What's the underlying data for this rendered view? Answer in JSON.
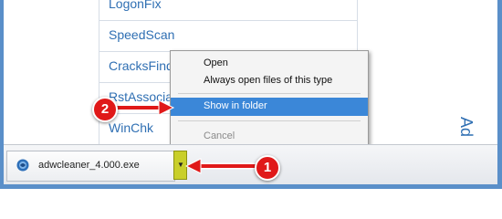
{
  "links": [
    "LogonFix",
    "SpeedScan",
    "CracksFinder",
    "RstAssociations",
    "WinChk"
  ],
  "side_text": "Ad",
  "context_menu": {
    "items": [
      {
        "label": "Open",
        "state": "normal"
      },
      {
        "label": "Always open files of this type",
        "state": "normal"
      },
      {
        "label": "Show in folder",
        "state": "selected"
      },
      {
        "label": "Cancel",
        "state": "disabled"
      }
    ]
  },
  "download": {
    "filename": "adwcleaner_4.000.exe",
    "icon": "shield-globe-icon",
    "dropdown_icon": "chevron-down-icon"
  },
  "callouts": [
    {
      "number": "1",
      "color": "#e01919"
    },
    {
      "number": "2",
      "color": "#e01919"
    }
  ],
  "colors": {
    "link": "#2f6fb3",
    "menu_highlight": "#3b87d8",
    "dropdown_highlight": "#c9cf2a",
    "arrow": "#e01919"
  }
}
